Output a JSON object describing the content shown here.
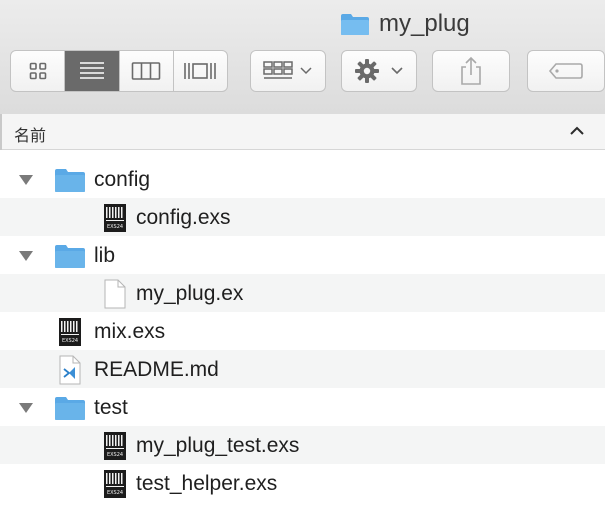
{
  "window": {
    "title": "my_plug"
  },
  "toolbar": {
    "view_icons": "icon-view-icon",
    "view_list": "list-view-icon",
    "view_columns": "column-view-icon",
    "view_coverflow": "coverflow-view-icon",
    "group": "group-by-icon",
    "action": "gear-icon",
    "share": "share-icon",
    "tags": "tag-icon"
  },
  "header": {
    "name_column": "名前"
  },
  "files": [
    {
      "name": "config",
      "kind": "folder",
      "level": 0,
      "expanded": true
    },
    {
      "name": "config.exs",
      "kind": "exs",
      "level": 1
    },
    {
      "name": "lib",
      "kind": "folder",
      "level": 0,
      "expanded": true
    },
    {
      "name": "my_plug.ex",
      "kind": "doc",
      "level": 1
    },
    {
      "name": "mix.exs",
      "kind": "exs",
      "level": 0
    },
    {
      "name": "README.md",
      "kind": "md",
      "level": 0
    },
    {
      "name": "test",
      "kind": "folder",
      "level": 0,
      "expanded": true
    },
    {
      "name": "my_plug_test.exs",
      "kind": "exs",
      "level": 1
    },
    {
      "name": "test_helper.exs",
      "kind": "exs",
      "level": 1
    }
  ],
  "colors": {
    "folder": "#69b4ea",
    "selected_segment": "#6a6a6a",
    "alt_row": "#f4f5f5"
  }
}
